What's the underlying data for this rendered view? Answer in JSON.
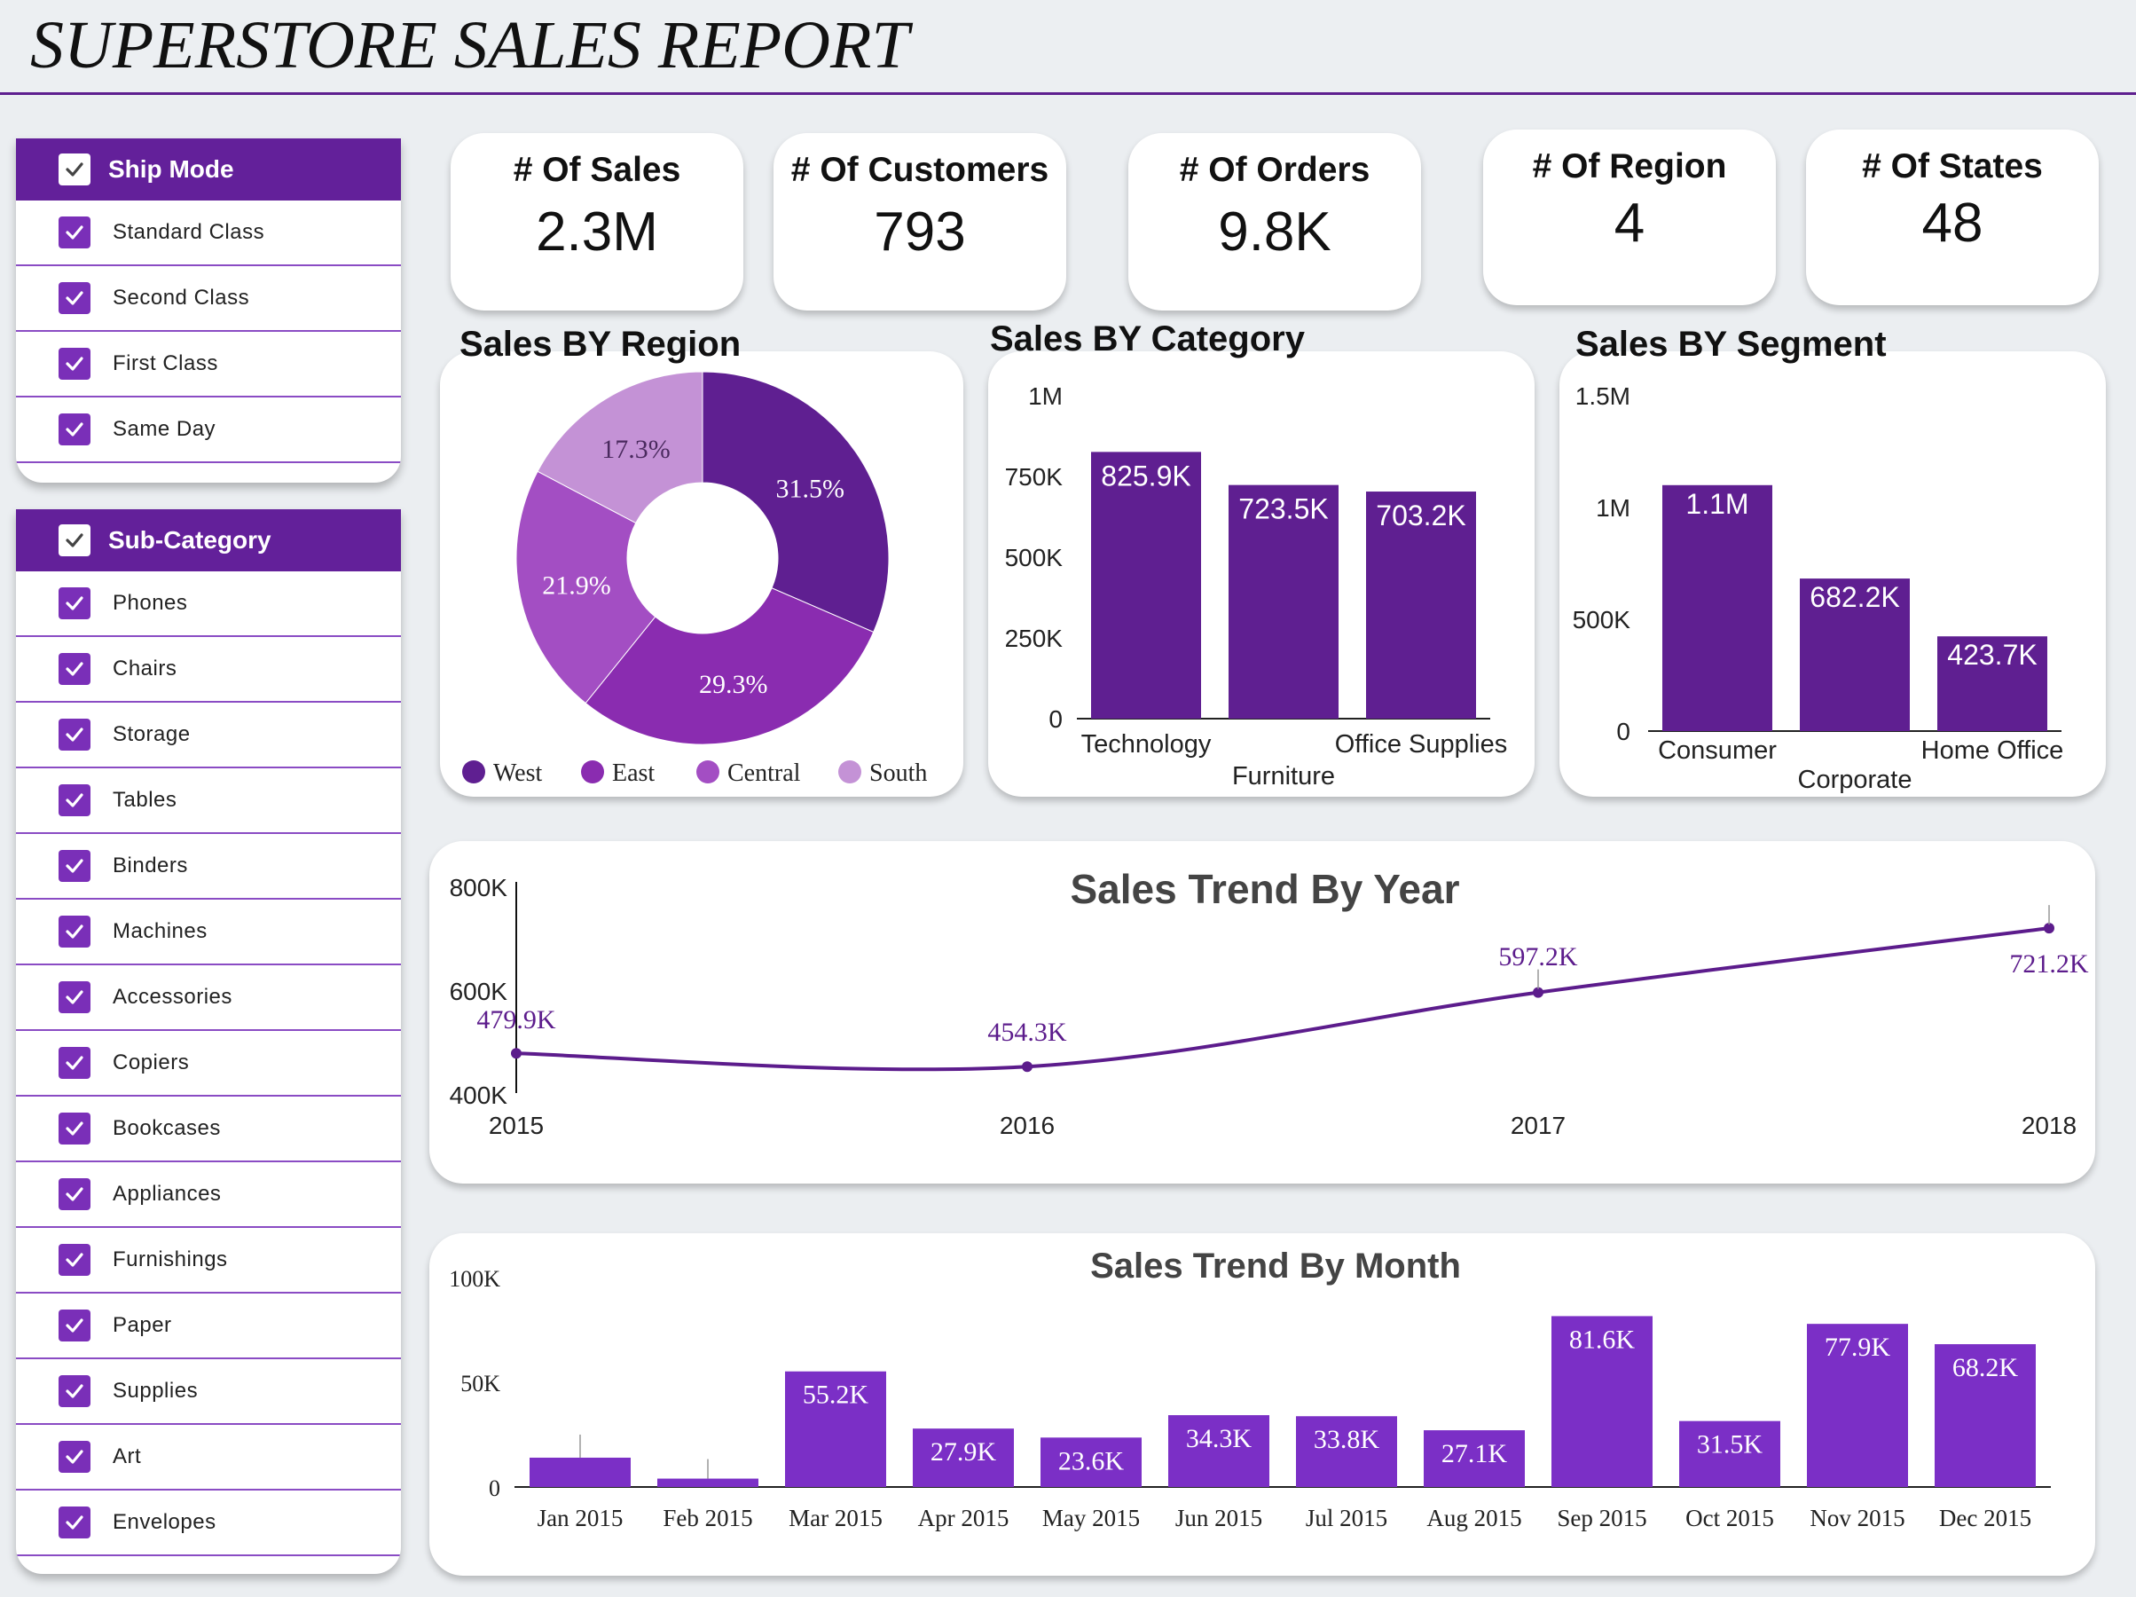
{
  "header": {
    "title": "SUPERSTORE SALES REPORT"
  },
  "slicers": {
    "ship_mode": {
      "title": "Ship Mode",
      "items": [
        "Standard Class",
        "Second Class",
        "First Class",
        "Same Day"
      ]
    },
    "sub_category": {
      "title": "Sub-Category",
      "items": [
        "Phones",
        "Chairs",
        "Storage",
        "Tables",
        "Binders",
        "Machines",
        "Accessories",
        "Copiers",
        "Bookcases",
        "Appliances",
        "Furnishings",
        "Paper",
        "Supplies",
        "Art",
        "Envelopes"
      ]
    }
  },
  "kpis": [
    {
      "label": "# Of Sales",
      "value": "2.3M"
    },
    {
      "label": "# Of Customers",
      "value": "793"
    },
    {
      "label": "# Of Orders",
      "value": "9.8K"
    },
    {
      "label": "# Of Region",
      "value": "4"
    },
    {
      "label": "# Of States",
      "value": "48"
    }
  ],
  "colors": {
    "accent": "#63209a",
    "bar": "#5f1f91",
    "month_bar": "#7b2fc6",
    "line": "#5c1c8c",
    "pie": [
      "#5f1f91",
      "#8a2cb0",
      "#a34ec3",
      "#c492d6"
    ]
  },
  "chart_data": [
    {
      "type": "pie",
      "title": "Sales BY Region",
      "categories": [
        "West",
        "East",
        "Central",
        "South"
      ],
      "values": [
        31.5,
        29.3,
        21.9,
        17.3
      ],
      "labels": [
        "31.5%",
        "29.3%",
        "21.9%",
        "17.3%"
      ],
      "legend": "bottom"
    },
    {
      "type": "bar",
      "title": "Sales BY Category",
      "categories": [
        "Technology",
        "Furniture",
        "Office Supplies"
      ],
      "values": [
        825.9,
        723.5,
        703.2
      ],
      "labels": [
        "825.9K",
        "723.5K",
        "703.2K"
      ],
      "unit": "K",
      "ylim": [
        0,
        1000
      ],
      "yticks": [
        0,
        250,
        500,
        750,
        1000
      ],
      "ytick_labels": [
        "0",
        "250K",
        "500K",
        "750K",
        "1M"
      ]
    },
    {
      "type": "bar",
      "title": "Sales BY Segment",
      "categories": [
        "Consumer",
        "Corporate",
        "Home Office"
      ],
      "values": [
        1100,
        682.2,
        423.7
      ],
      "labels": [
        "1.1M",
        "682.2K",
        "423.7K"
      ],
      "unit": "K",
      "ylim": [
        0,
        1500
      ],
      "yticks": [
        0,
        500,
        1000,
        1500
      ],
      "ytick_labels": [
        "0",
        "500K",
        "1M",
        "1.5M"
      ]
    },
    {
      "type": "line",
      "title": "Sales Trend By Year",
      "x": [
        "2015",
        "2016",
        "2017",
        "2018"
      ],
      "values": [
        479.9,
        454.3,
        597.2,
        721.2
      ],
      "labels": [
        "479.9K",
        "454.3K",
        "597.2K",
        "721.2K"
      ],
      "unit": "K",
      "ylim": [
        400,
        800
      ],
      "yticks": [
        400,
        600,
        800
      ],
      "ytick_labels": [
        "400K",
        "600K",
        "800K"
      ]
    },
    {
      "type": "bar",
      "title": "Sales Trend By Month",
      "categories": [
        "Jan 2015",
        "Feb 2015",
        "Mar 2015",
        "Apr 2015",
        "May 2015",
        "Jun 2015",
        "Jul 2015",
        "Aug 2015",
        "Sep 2015",
        "Oct 2015",
        "Nov 2015",
        "Dec 2015"
      ],
      "values": [
        14,
        4,
        55.2,
        27.9,
        23.6,
        34.3,
        33.8,
        27.1,
        81.6,
        31.5,
        77.9,
        68.2
      ],
      "labels": [
        "",
        "",
        "55.2K",
        "27.9K",
        "23.6K",
        "34.3K",
        "33.8K",
        "27.1K",
        "81.6K",
        "31.5K",
        "77.9K",
        "68.2K"
      ],
      "unit": "K",
      "ylim": [
        0,
        100
      ],
      "yticks": [
        0,
        50,
        100
      ],
      "ytick_labels": [
        "0",
        "50K",
        "100K"
      ]
    }
  ]
}
